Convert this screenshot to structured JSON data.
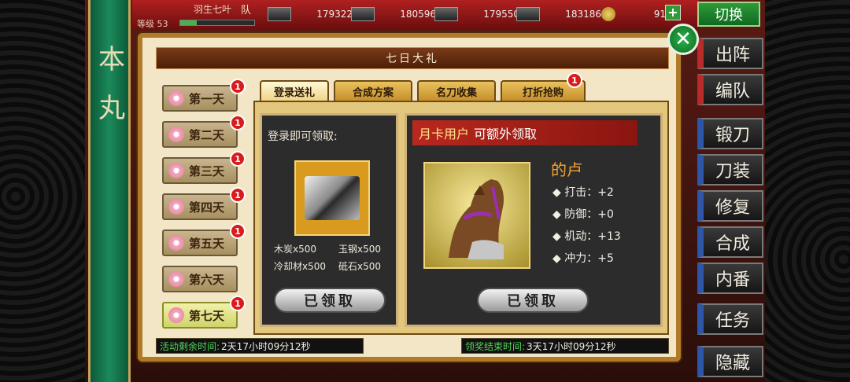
{
  "player": {
    "name": "羽生七叶",
    "level": "等级 53",
    "team_tab": "队"
  },
  "resources": [
    {
      "icon": "charcoal-icon",
      "value": "179322"
    },
    {
      "icon": "steel-icon",
      "value": "180596"
    },
    {
      "icon": "coolant-icon",
      "value": "179550"
    },
    {
      "icon": "whetstone-icon",
      "value": "183186"
    }
  ],
  "coins": {
    "icon": "coin-icon",
    "value": "91",
    "plus": "+"
  },
  "switch_label": "切换",
  "honmaru": [
    "本",
    "丸"
  ],
  "menu": [
    "出阵",
    "编队",
    "锻刀",
    "刀装",
    "修复",
    "合成",
    "内番",
    "任务",
    "隐藏"
  ],
  "modal": {
    "title": "七日大礼",
    "close": "✕",
    "days": [
      {
        "label": "第一天",
        "badge": "1"
      },
      {
        "label": "第二天",
        "badge": "1"
      },
      {
        "label": "第三天",
        "badge": "1"
      },
      {
        "label": "第四天",
        "badge": "1"
      },
      {
        "label": "第五天",
        "badge": "1"
      },
      {
        "label": "第六天",
        "badge": ""
      },
      {
        "label": "第七天",
        "badge": "1"
      }
    ],
    "tabs": [
      {
        "label": "登录送礼",
        "badge": ""
      },
      {
        "label": "合成方案",
        "badge": ""
      },
      {
        "label": "名刀收集",
        "badge": ""
      },
      {
        "label": "打折抢购",
        "badge": "1"
      }
    ],
    "login_panel": {
      "heading": "登录即可领取:",
      "materials": [
        "木炭x500",
        "玉钢x500",
        "冷却材x500",
        "砥石x500"
      ],
      "claim": "已领取"
    },
    "monthly_panel": {
      "ribbon_gold": "月卡用户",
      "ribbon_rest": "可额外领取",
      "horse_name": "的卢",
      "stats": [
        {
          "label": "◆ 打击：",
          "value": "+2"
        },
        {
          "label": "◆ 防御：",
          "value": "+0"
        },
        {
          "label": "◆ 机动：",
          "value": "+13"
        },
        {
          "label": "◆ 冲力：",
          "value": "+5"
        }
      ],
      "claim": "已领取"
    },
    "timers": [
      {
        "key": "活动剩余时间:",
        "value": "2天17小时09分12秒"
      },
      {
        "key": "领奖结束时间:",
        "value": "3天17小时09分12秒"
      }
    ]
  }
}
